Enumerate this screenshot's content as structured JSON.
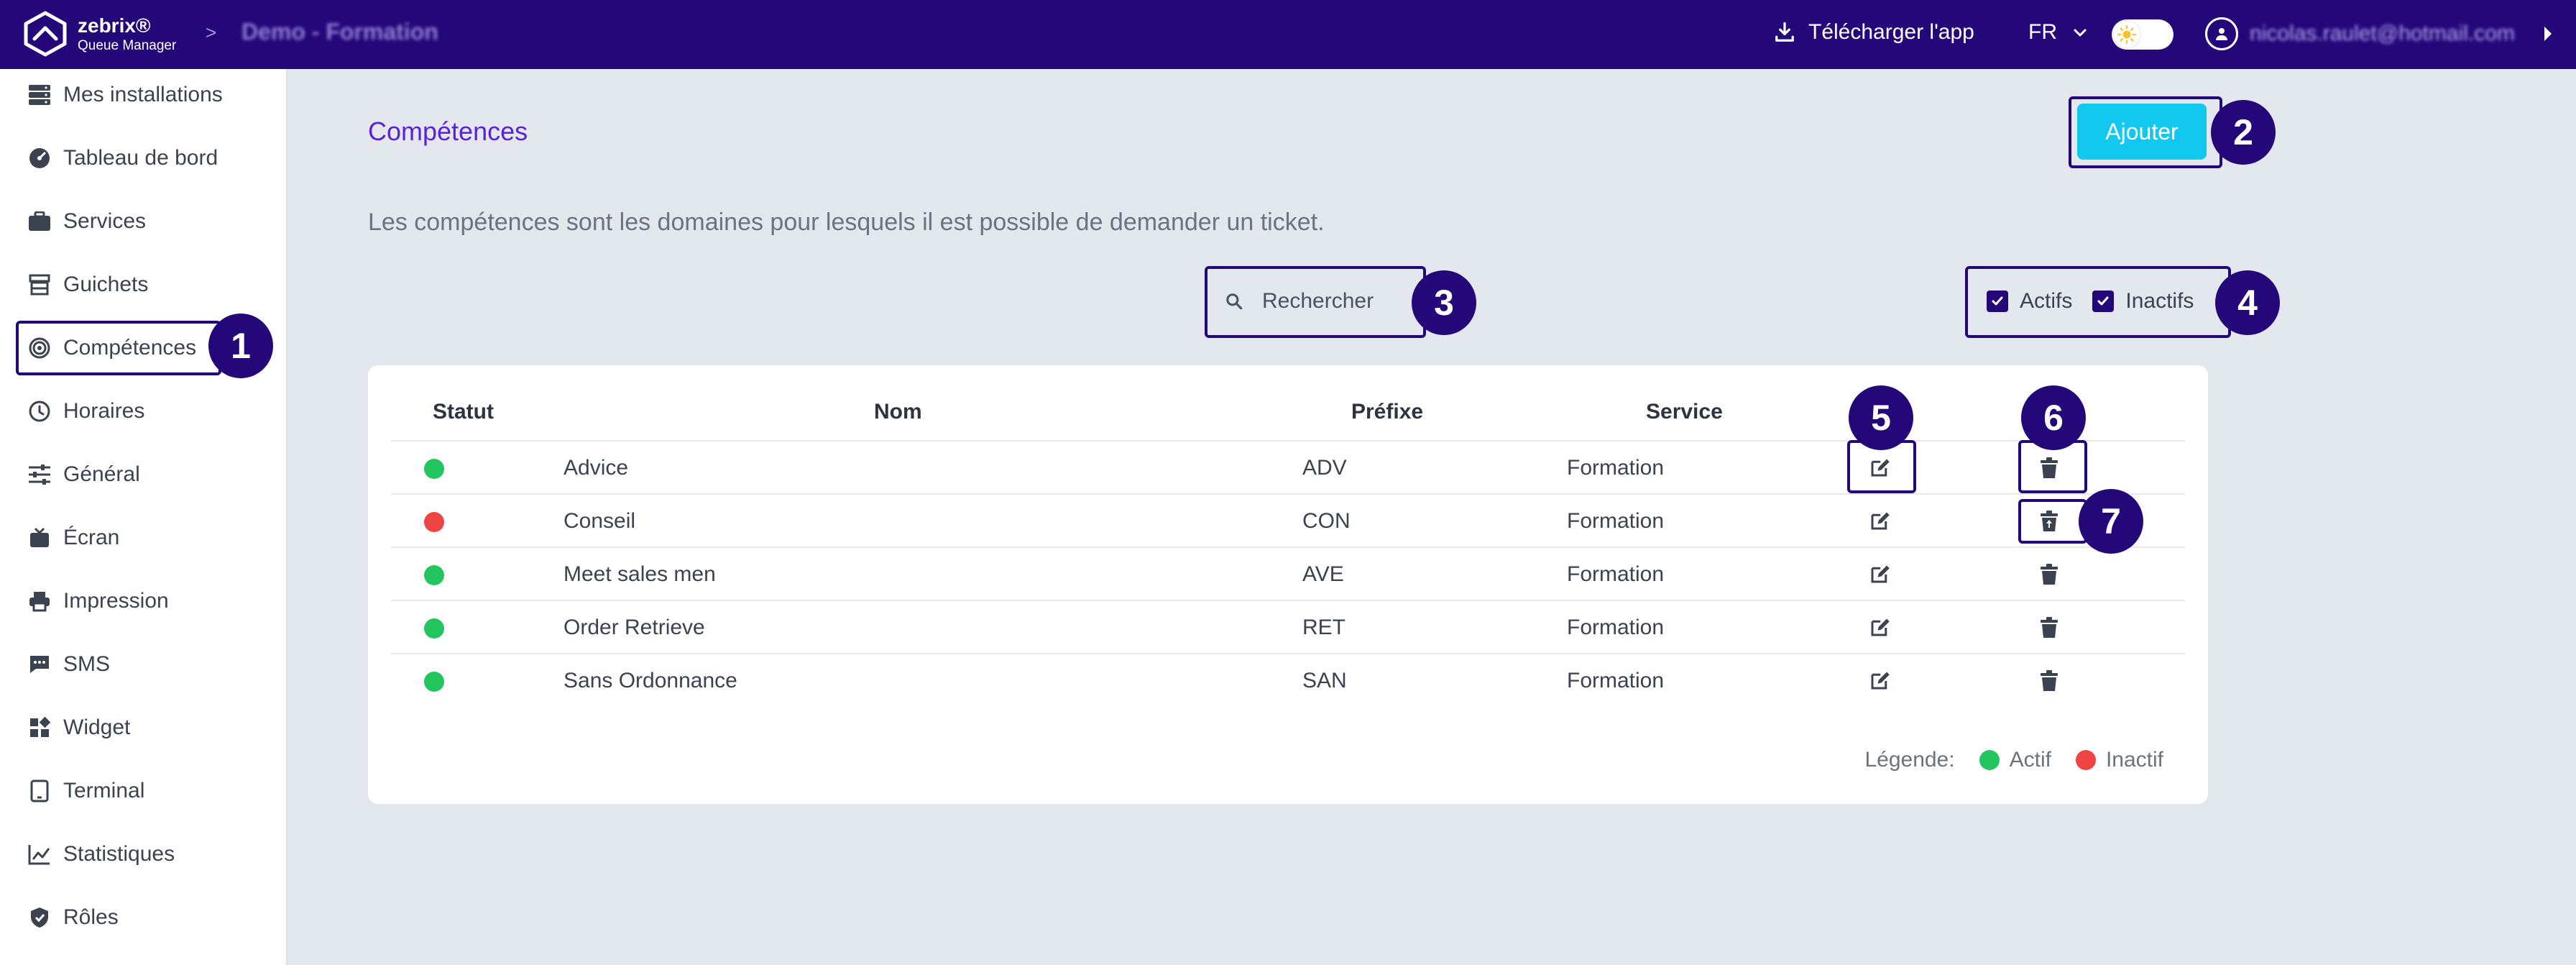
{
  "header": {
    "brand_name": "zebrix®",
    "brand_sub": "Queue Manager",
    "breadcrumb_sep": ">",
    "breadcrumb_title": "Demo - Formation",
    "download_label": "Télécharger l'app",
    "language": "FR",
    "user_email": "nicolas.raulet@hotmail.com"
  },
  "sidebar": {
    "items": [
      {
        "label": "Mes installations",
        "icon": "servers-icon"
      },
      {
        "label": "Tableau de bord",
        "icon": "dashboard-icon"
      },
      {
        "label": "Services",
        "icon": "briefcase-icon"
      },
      {
        "label": "Guichets",
        "icon": "counter-icon"
      },
      {
        "label": "Compétences",
        "icon": "target-icon"
      },
      {
        "label": "Horaires",
        "icon": "clock-icon"
      },
      {
        "label": "Général",
        "icon": "sliders-icon"
      },
      {
        "label": "Écran",
        "icon": "tv-icon"
      },
      {
        "label": "Impression",
        "icon": "printer-icon"
      },
      {
        "label": "SMS",
        "icon": "sms-icon"
      },
      {
        "label": "Widget",
        "icon": "widget-icon"
      },
      {
        "label": "Terminal",
        "icon": "tablet-icon"
      },
      {
        "label": "Statistiques",
        "icon": "chart-icon"
      },
      {
        "label": "Rôles",
        "icon": "shield-icon"
      }
    ],
    "active": "Compétences"
  },
  "main": {
    "title": "Compétences",
    "add_label": "Ajouter",
    "description": "Les compétences sont les domaines pour lesquels il est possible de demander un ticket.",
    "search_placeholder": "Rechercher",
    "filter_active": "Actifs",
    "filter_inactive": "Inactifs",
    "columns": {
      "status": "Statut",
      "name": "Nom",
      "prefix": "Préfixe",
      "service": "Service"
    },
    "rows": [
      {
        "status": "active",
        "name": "Advice",
        "prefix": "ADV",
        "service": "Formation"
      },
      {
        "status": "inactive",
        "name": "Conseil",
        "prefix": "CON",
        "service": "Formation"
      },
      {
        "status": "active",
        "name": "Meet sales men",
        "prefix": "AVE",
        "service": "Formation"
      },
      {
        "status": "active",
        "name": "Order Retrieve",
        "prefix": "RET",
        "service": "Formation"
      },
      {
        "status": "active",
        "name": "Sans Ordonnance",
        "prefix": "SAN",
        "service": "Formation"
      }
    ],
    "legend": {
      "label": "Légende:",
      "active": "Actif",
      "inactive": "Inactif"
    }
  },
  "colors": {
    "header_bg": "#24087a",
    "accent": "#5b21d9",
    "button": "#12c8ee",
    "active_dot": "#22c55e",
    "inactive_dot": "#ef4444"
  },
  "annotations": [
    "1",
    "2",
    "3",
    "4",
    "5",
    "6",
    "7"
  ]
}
